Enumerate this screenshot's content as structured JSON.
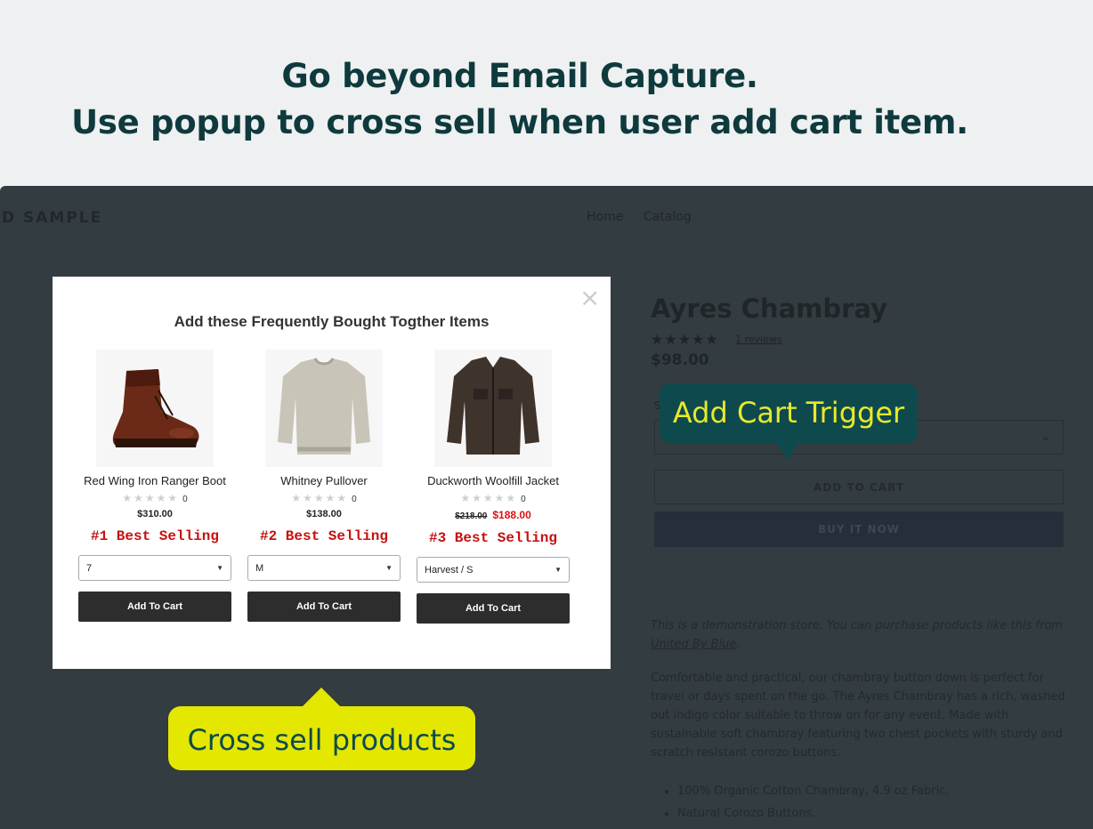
{
  "headline": {
    "line1": "Go beyond Email Capture.",
    "line2": "Use popup to cross sell when user add cart item."
  },
  "store": {
    "name": "D SAMPLE",
    "nav": [
      "Home",
      "Catalog"
    ],
    "product": {
      "title": "Ayres Chambray",
      "stars": "★★★★★",
      "reviews": "1 reviews",
      "price": "$98.00",
      "size_label": "S",
      "add_to_cart": "ADD TO CART",
      "buy_now": "BUY IT NOW",
      "demo_note_pre": "This is a demonstration store. You can purchase products like this from ",
      "demo_note_link": "United By Blue",
      "demo_note_post": ".",
      "description": "Comfortable and practical, our chambray button down is perfect for travel or days spent on the go. The Ayres Chambray has a rich, washed out indigo color suitable to throw on for any event. Made with sustainable soft chambray featuring two chest pockets with sturdy and scratch resistant corozo buttons.",
      "bullets": [
        "100% Organic Cotton Chambray, 4.9 oz Fabric.",
        "Natural Corozo Buttons."
      ]
    }
  },
  "callouts": {
    "add_cart_trigger": "Add Cart Trigger",
    "cross_sell": "Cross sell products"
  },
  "popup": {
    "close": "×",
    "title": "Add these Frequently Bought Togther Items",
    "stars": "★★★★★",
    "items": [
      {
        "name": "Red Wing Iron Ranger Boot",
        "rating_count": "0",
        "price": "$310.00",
        "old_price": "",
        "rank": "#1 Best Selling",
        "option": "7",
        "button": "Add To Cart"
      },
      {
        "name": "Whitney Pullover",
        "rating_count": "0",
        "price": "$138.00",
        "old_price": "",
        "rank": "#2 Best Selling",
        "option": "M",
        "button": "Add To Cart"
      },
      {
        "name": "Duckworth Woolfill Jacket",
        "rating_count": "0",
        "price": "$188.00",
        "old_price": "$218.00",
        "rank": "#3 Best Selling",
        "option": "Harvest / S",
        "button": "Add To Cart"
      }
    ]
  },
  "colors": {
    "headline": "#0f3a3d",
    "overlay": "#333c40",
    "trigger_bubble": "#0e4a4d",
    "trigger_text": "#e8e92a",
    "cross_bubble": "#e4e800",
    "rank_red": "#c81010"
  },
  "icons": [
    "close-icon",
    "star-icon",
    "chevron-down-icon",
    "caret-down-icon"
  ]
}
